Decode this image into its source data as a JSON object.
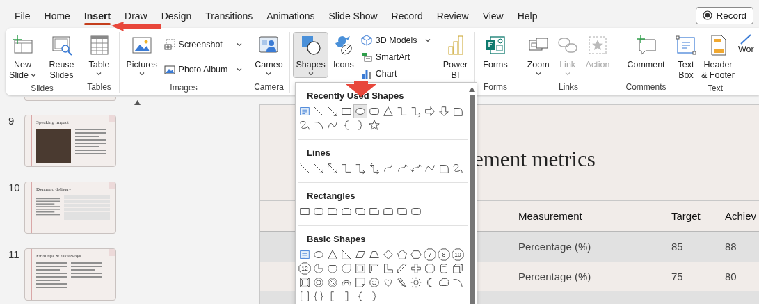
{
  "tabs": [
    {
      "label": "File",
      "selected": false
    },
    {
      "label": "Home",
      "selected": false
    },
    {
      "label": "Insert",
      "selected": true
    },
    {
      "label": "Draw",
      "selected": false
    },
    {
      "label": "Design",
      "selected": false
    },
    {
      "label": "Transitions",
      "selected": false
    },
    {
      "label": "Animations",
      "selected": false
    },
    {
      "label": "Slide Show",
      "selected": false
    },
    {
      "label": "Record",
      "selected": false
    },
    {
      "label": "Review",
      "selected": false
    },
    {
      "label": "View",
      "selected": false
    },
    {
      "label": "Help",
      "selected": false
    }
  ],
  "record_button": {
    "label": "Record"
  },
  "ribbon": {
    "groups": [
      {
        "label": "Slides",
        "items": [
          {
            "kind": "large",
            "label": "New Slide",
            "menu": true,
            "pressed": false,
            "disabled": false
          },
          {
            "kind": "large",
            "label": "Reuse Slides",
            "menu": false,
            "pressed": false,
            "disabled": false
          }
        ]
      },
      {
        "label": "Tables",
        "items": [
          {
            "kind": "large",
            "label": "Table",
            "menu": true,
            "pressed": false,
            "disabled": false
          }
        ]
      },
      {
        "label": "Images",
        "items": [
          {
            "kind": "large",
            "label": "Pictures",
            "menu": true,
            "pressed": false,
            "disabled": false
          },
          {
            "kind": "stack",
            "items": [
              {
                "label": "Screenshot",
                "menu": true
              },
              {
                "label": "Photo Album",
                "menu": true
              }
            ]
          }
        ]
      },
      {
        "label": "Camera",
        "items": [
          {
            "kind": "large",
            "label": "Cameo",
            "menu": true,
            "pressed": false,
            "disabled": false
          }
        ]
      },
      {
        "items": [
          {
            "kind": "large",
            "label": "Shapes",
            "menu": true,
            "pressed": true,
            "disabled": false
          },
          {
            "kind": "large",
            "label": "Icons",
            "menu": false,
            "pressed": false,
            "disabled": false
          },
          {
            "kind": "stack",
            "items": [
              {
                "label": "3D Models",
                "menu": true
              },
              {
                "label": "SmartArt",
                "menu": false
              },
              {
                "label": "Chart",
                "menu": false
              }
            ]
          }
        ]
      },
      {
        "items": [
          {
            "kind": "large",
            "label": "Power BI",
            "menu": false,
            "pressed": false,
            "disabled": false
          }
        ]
      },
      {
        "label": "Forms",
        "items": [
          {
            "kind": "large",
            "label": "Forms",
            "menu": false,
            "pressed": false,
            "disabled": false
          }
        ]
      },
      {
        "label": "Links",
        "items": [
          {
            "kind": "large",
            "label": "Zoom",
            "menu": true,
            "pressed": false,
            "disabled": false
          },
          {
            "kind": "large",
            "label": "Link",
            "menu": true,
            "pressed": false,
            "disabled": true
          },
          {
            "kind": "large",
            "label": "Action",
            "menu": false,
            "pressed": false,
            "disabled": true
          }
        ]
      },
      {
        "label": "Comments",
        "items": [
          {
            "kind": "large",
            "label": "Comment",
            "menu": false,
            "pressed": false,
            "disabled": false
          }
        ]
      },
      {
        "label": "Text",
        "items": [
          {
            "kind": "large",
            "label": "Text Box",
            "menu": false,
            "pressed": false,
            "disabled": false
          },
          {
            "kind": "large",
            "label": "Header & Footer",
            "menu": false,
            "pressed": false,
            "disabled": false
          },
          {
            "kind": "large",
            "label": "Wor",
            "menu": false,
            "pressed": false,
            "disabled": false
          }
        ]
      }
    ]
  },
  "slides_pane": {
    "items": [
      {
        "number": "9",
        "title": "Speaking impact",
        "kind": "photo-text"
      },
      {
        "number": "10",
        "title": "Dynamic delivery",
        "kind": "table"
      },
      {
        "number": "11",
        "title": "Final tips & takeaways",
        "kind": "bullets"
      }
    ]
  },
  "slide": {
    "title": "ement metrics",
    "table": {
      "columns": [
        "Measurement",
        "Target",
        "Achiev"
      ],
      "rows": [
        [
          "Percentage (%)",
          "85",
          "88"
        ],
        [
          "Percentage (%)",
          "75",
          "80"
        ]
      ]
    }
  },
  "shapes_gallery": {
    "sections": [
      {
        "title": "Recently Used Shapes",
        "shapes": [
          {
            "kind": "text-box",
            "selected": false
          },
          {
            "kind": "line",
            "selected": false
          },
          {
            "kind": "arrow-line",
            "selected": false
          },
          {
            "kind": "rectangle",
            "selected": false
          },
          {
            "kind": "ellipse",
            "selected": true
          },
          {
            "kind": "rounded-rectangle",
            "selected": false
          },
          {
            "kind": "triangle",
            "selected": false
          },
          {
            "kind": "elbow-connector",
            "selected": false
          },
          {
            "kind": "elbow-arrow",
            "selected": false
          },
          {
            "kind": "right-arrow",
            "selected": false
          },
          {
            "kind": "down-arrow",
            "selected": false
          },
          {
            "kind": "freeform",
            "selected": false
          },
          {
            "kind": "scribble",
            "selected": false
          },
          {
            "kind": "arc",
            "selected": false
          },
          {
            "kind": "curve",
            "selected": false
          },
          {
            "kind": "left-brace",
            "selected": false
          },
          {
            "kind": "right-brace",
            "selected": false
          },
          {
            "kind": "star",
            "selected": false
          }
        ]
      },
      {
        "title": "Lines",
        "shapes": [
          {
            "kind": "line",
            "selected": false
          },
          {
            "kind": "arrow-line",
            "selected": false
          },
          {
            "kind": "double-arrow-line",
            "selected": false
          },
          {
            "kind": "elbow-connector",
            "selected": false
          },
          {
            "kind": "elbow-arrow",
            "selected": false
          },
          {
            "kind": "elbow-double-arrow",
            "selected": false
          },
          {
            "kind": "curved-connector",
            "selected": false
          },
          {
            "kind": "curved-arrow",
            "selected": false
          },
          {
            "kind": "curved-double-arrow",
            "selected": false
          },
          {
            "kind": "curve",
            "selected": false
          },
          {
            "kind": "freeform",
            "selected": false
          },
          {
            "kind": "scribble",
            "selected": false
          }
        ]
      },
      {
        "title": "Rectangles",
        "shapes": [
          {
            "kind": "rectangle",
            "selected": false
          },
          {
            "kind": "rounded-rectangle",
            "selected": false
          },
          {
            "kind": "round-corner-rectangle",
            "selected": false
          },
          {
            "kind": "snip-same-side-rectangle",
            "selected": false
          },
          {
            "kind": "snip-diagonal-rectangle",
            "selected": false
          },
          {
            "kind": "snip-corner-rectangle",
            "selected": false
          },
          {
            "kind": "round-same-side-rectangle",
            "selected": false
          },
          {
            "kind": "round-diagonal-rectangle",
            "selected": false
          },
          {
            "kind": "rounded-rectangle",
            "selected": false
          }
        ]
      },
      {
        "title": "Basic Shapes",
        "shapes": [
          {
            "kind": "text-box",
            "selected": false
          },
          {
            "kind": "ellipse",
            "selected": false
          },
          {
            "kind": "triangle",
            "selected": false
          },
          {
            "kind": "right-triangle",
            "selected": false
          },
          {
            "kind": "parallelogram",
            "selected": false
          },
          {
            "kind": "trapezoid",
            "selected": false
          },
          {
            "kind": "diamond",
            "selected": false
          },
          {
            "kind": "pentagon",
            "selected": false
          },
          {
            "kind": "hexagon",
            "selected": false
          },
          {
            "kind": "numbered-polygon",
            "label": "7",
            "selected": false
          },
          {
            "kind": "numbered-polygon",
            "label": "8",
            "selected": false
          },
          {
            "kind": "numbered-polygon",
            "label": "10",
            "selected": false
          },
          {
            "kind": "numbered-polygon",
            "label": "12",
            "selected": false
          },
          {
            "kind": "pie",
            "selected": false
          },
          {
            "kind": "chord",
            "selected": false
          },
          {
            "kind": "teardrop",
            "selected": false
          },
          {
            "kind": "frame",
            "selected": false
          },
          {
            "kind": "half-frame",
            "selected": false
          },
          {
            "kind": "l-shape",
            "selected": false
          },
          {
            "kind": "diagonal-stripe",
            "selected": false
          },
          {
            "kind": "cross",
            "selected": false
          },
          {
            "kind": "plaque",
            "selected": false
          },
          {
            "kind": "cylinder",
            "selected": false
          },
          {
            "kind": "cube",
            "selected": false
          },
          {
            "kind": "bevel",
            "selected": false
          },
          {
            "kind": "donut",
            "selected": false
          },
          {
            "kind": "no-symbol",
            "selected": false
          },
          {
            "kind": "block-arc",
            "selected": false
          },
          {
            "kind": "folded-corner",
            "selected": false
          },
          {
            "kind": "smiley",
            "selected": false
          },
          {
            "kind": "heart",
            "selected": false
          },
          {
            "kind": "lightning",
            "selected": false
          },
          {
            "kind": "sun",
            "selected": false
          },
          {
            "kind": "moon",
            "selected": false
          },
          {
            "kind": "cloud",
            "selected": false
          },
          {
            "kind": "arc",
            "selected": false
          },
          {
            "kind": "double-bracket",
            "selected": false
          },
          {
            "kind": "double-brace",
            "selected": false
          },
          {
            "kind": "left-bracket",
            "selected": false
          },
          {
            "kind": "right-bracket",
            "selected": false
          },
          {
            "kind": "left-brace",
            "selected": false
          },
          {
            "kind": "right-brace",
            "selected": false
          }
        ]
      }
    ]
  }
}
